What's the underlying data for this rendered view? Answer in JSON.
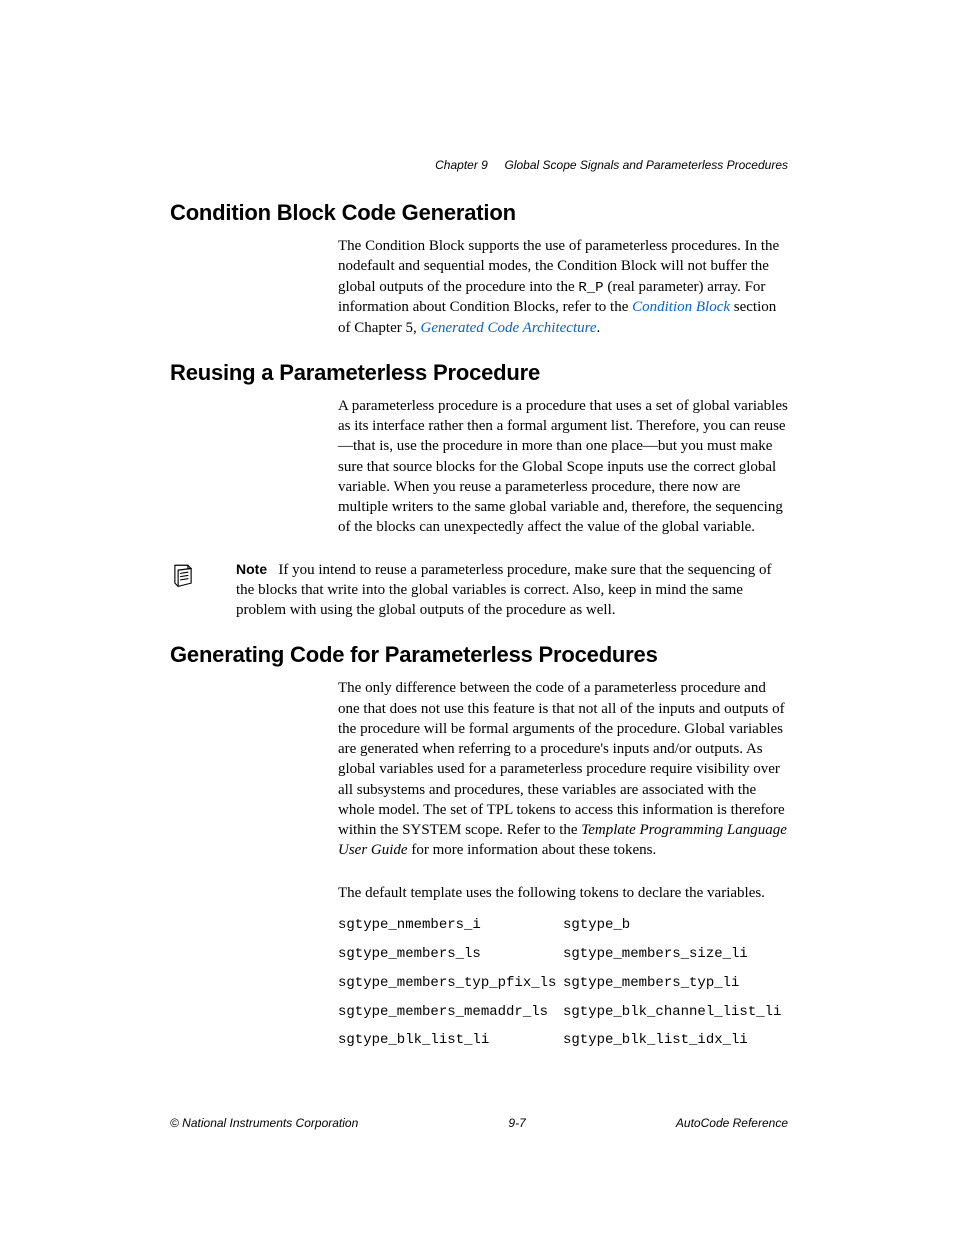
{
  "header": {
    "chapter": "Chapter 9",
    "chapter_title": "Global Scope Signals and Parameterless Procedures"
  },
  "sections": {
    "s1": {
      "heading": "Condition Block Code Generation",
      "p1a": "The Condition Block supports the use of parameterless procedures. In the nodefault and sequential modes, the Condition Block will not buffer the global outputs of the procedure into the ",
      "p1_mono": "R_P",
      "p1b": " (real parameter) array. For information about Condition Blocks, refer to the ",
      "link1": "Condition Block",
      "p1c": " section of Chapter 5, ",
      "link2": "Generated Code Architecture",
      "p1d": "."
    },
    "s2": {
      "heading": "Reusing a Parameterless Procedure",
      "p1": "A parameterless procedure is a procedure that uses a set of global variables as its interface rather then a formal argument list. Therefore, you can reuse—that is, use the procedure in more than one place—but you must make sure that source blocks for the Global Scope inputs use the correct global variable. When you reuse a parameterless procedure, there now are multiple writers to the same global variable and, therefore, the sequencing of the blocks can unexpectedly affect the value of the global variable.",
      "note_label": "Note",
      "note_body": "If you intend to reuse a parameterless procedure, make sure that the sequencing of the blocks that write into the global variables is correct. Also, keep in mind the same problem with using the global outputs of the procedure as well."
    },
    "s3": {
      "heading": "Generating Code for Parameterless Procedures",
      "p1a": "The only difference between the code of a parameterless procedure and one that does not use this feature is that not all of the inputs and outputs of the procedure will be formal arguments of the procedure. Global variables are generated when referring to a procedure's inputs and/or outputs. As global variables used for a parameterless procedure require visibility over all subsystems and procedures, these variables are associated with the whole model. The set of TPL tokens to access this information is therefore within the SYSTEM scope. Refer to the ",
      "ital": "Template Programming Language User Guide",
      "p1b": " for more information about these tokens.",
      "p2": "The default template uses the following tokens to declare the variables.",
      "tokens": [
        [
          "sgtype_nmembers_i",
          "sgtype_b"
        ],
        [
          "sgtype_members_ls",
          "sgtype_members_size_li"
        ],
        [
          "sgtype_members_typ_pfix_ls",
          "sgtype_members_typ_li"
        ],
        [
          "sgtype_members_memaddr_ls",
          "sgtype_blk_channel_list_li"
        ],
        [
          "sgtype_blk_list_li",
          "sgtype_blk_list_idx_li"
        ]
      ]
    }
  },
  "footer": {
    "left": "© National Instruments Corporation",
    "center": "9-7",
    "right": "AutoCode Reference"
  }
}
